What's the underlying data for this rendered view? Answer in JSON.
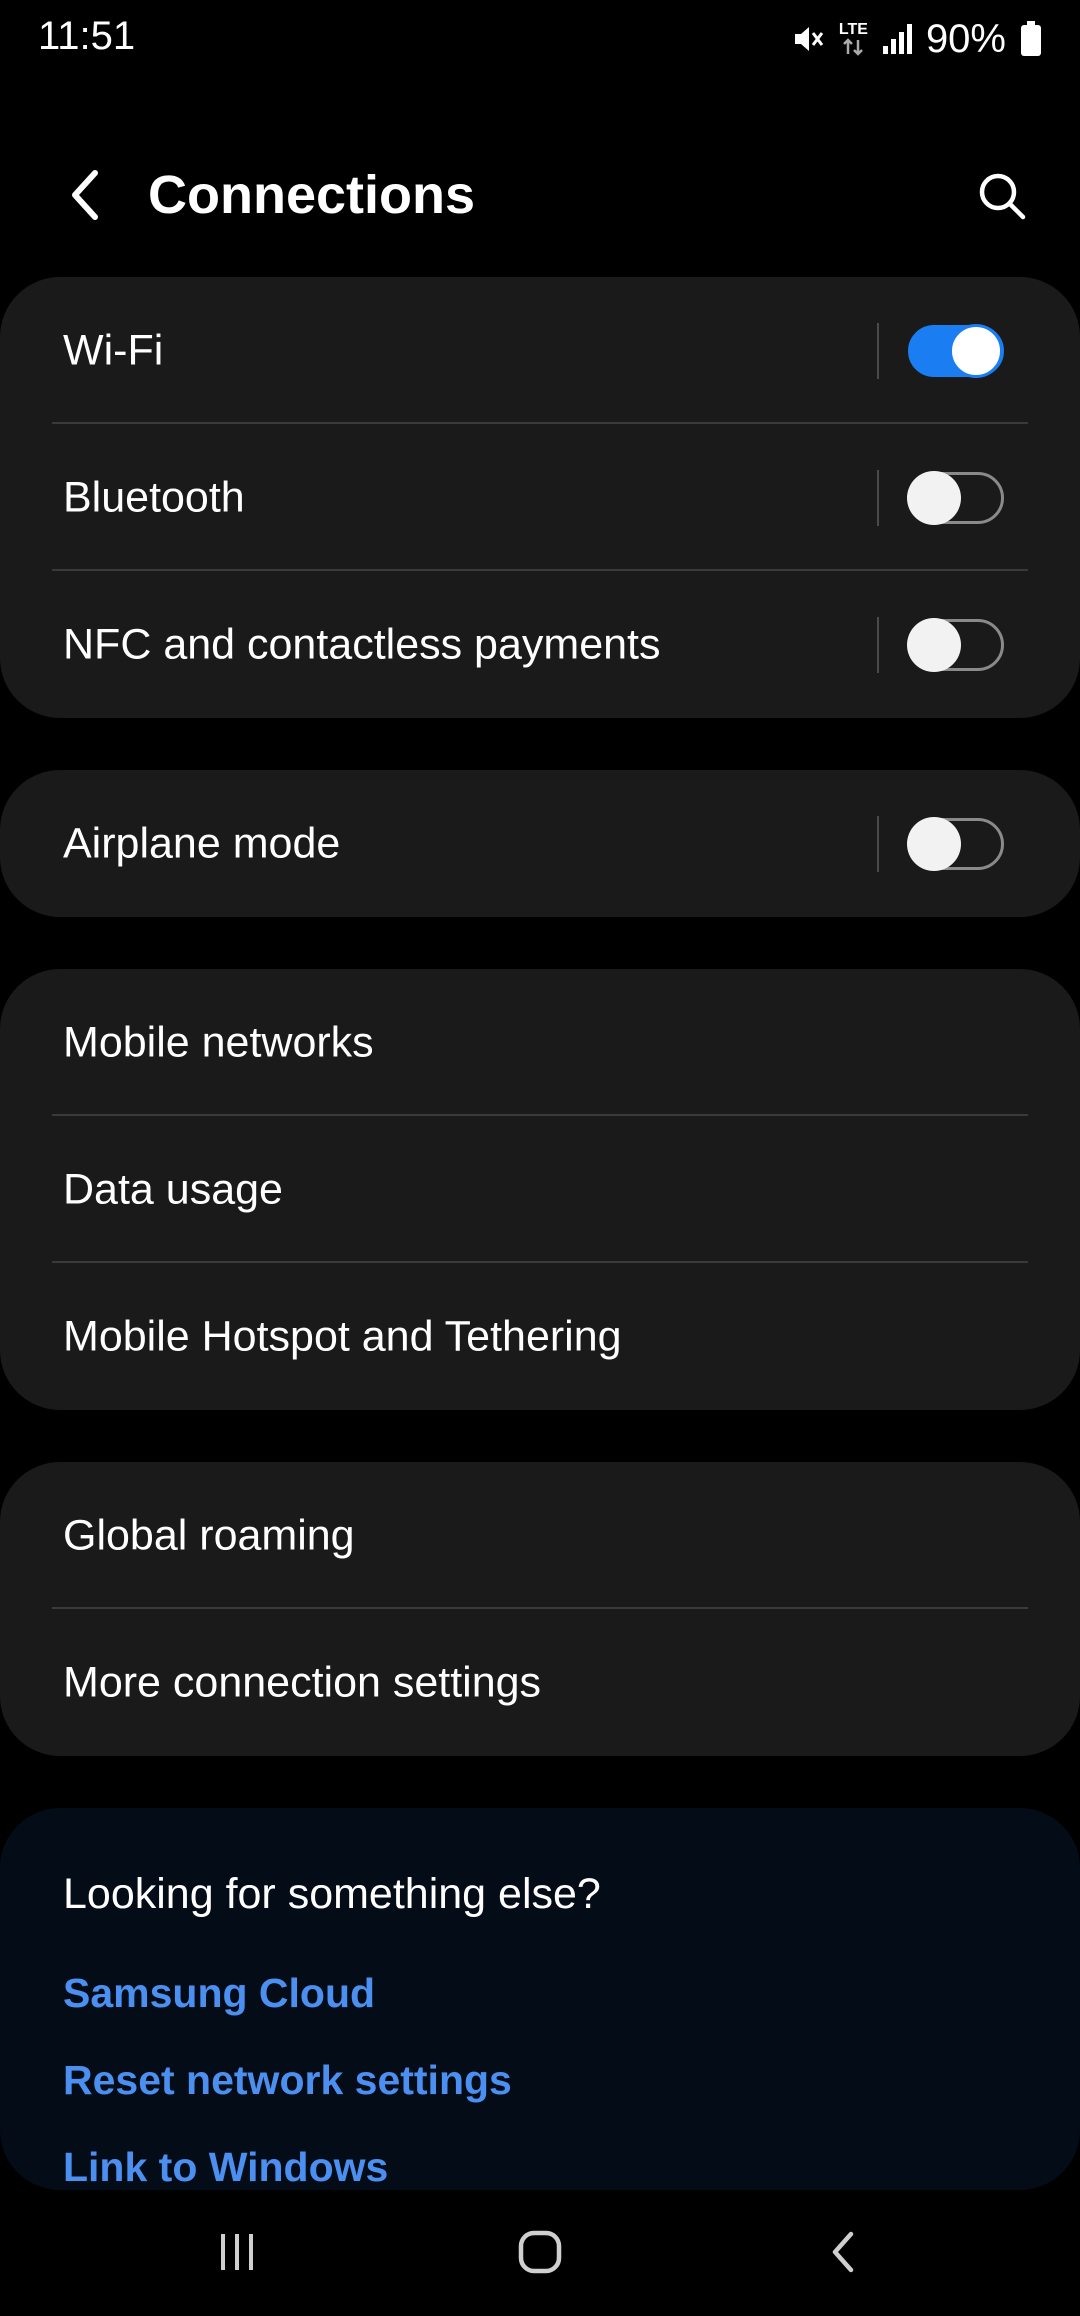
{
  "status_bar": {
    "time": "11:51",
    "network_type": "LTE",
    "battery": "90%",
    "icons": [
      "mute-icon",
      "lte-data-icon",
      "signal-icon",
      "battery-icon"
    ]
  },
  "header": {
    "title": "Connections",
    "back_icon": "back-arrow-icon",
    "search_icon": "search-icon"
  },
  "groups": [
    {
      "items": [
        {
          "label": "Wi-Fi",
          "toggle": true,
          "on": true
        },
        {
          "label": "Bluetooth",
          "toggle": true,
          "on": false
        },
        {
          "label": "NFC and contactless payments",
          "toggle": true,
          "on": false
        }
      ]
    },
    {
      "items": [
        {
          "label": "Airplane mode",
          "toggle": true,
          "on": false
        }
      ]
    },
    {
      "items": [
        {
          "label": "Mobile networks"
        },
        {
          "label": "Data usage"
        },
        {
          "label": "Mobile Hotspot and Tethering"
        }
      ]
    },
    {
      "items": [
        {
          "label": "Global roaming"
        },
        {
          "label": "More connection settings"
        }
      ]
    }
  ],
  "suggestions": {
    "title": "Looking for something else?",
    "links": [
      "Samsung Cloud",
      "Reset network settings",
      "Link to Windows"
    ]
  },
  "colors": {
    "accent": "#1a7ef2",
    "link": "#4b8ff0",
    "card": "#1a1a1a",
    "background": "#000000"
  },
  "nav_bar": {
    "icons": [
      "recent-apps-icon",
      "home-icon",
      "back-icon"
    ]
  }
}
